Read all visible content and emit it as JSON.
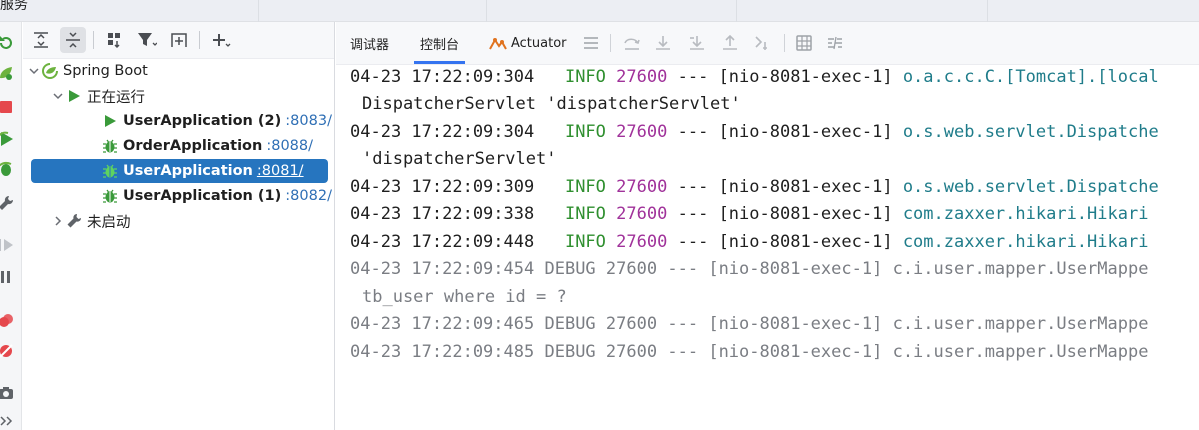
{
  "window": {
    "title": "服务"
  },
  "tree": {
    "root": {
      "label": "Spring Boot"
    },
    "running_group": {
      "label": "正在运行"
    },
    "apps": [
      {
        "name": "UserApplication (2)",
        "port": ":8083/"
      },
      {
        "name": "OrderApplication",
        "port": ":8088/"
      },
      {
        "name": "UserApplication",
        "port": ":8081/"
      },
      {
        "name": "UserApplication (1)",
        "port": ":8082/"
      }
    ],
    "stopped_group": {
      "label": "未启动"
    }
  },
  "console": {
    "tabs": [
      {
        "label": "调试器"
      },
      {
        "label": "控制台"
      },
      {
        "label": "Actuator"
      }
    ],
    "active_tab": "控制台",
    "lines": [
      {
        "time": "04-23 17:22:09:304",
        "level": " INFO",
        "pid": "27600",
        "sep": "---",
        "thread": "[nio-8081-exec-1]",
        "logger": "o.a.c.c.C.[Tomcat].[local"
      },
      {
        "cont": "DispatcherServlet 'dispatcherServlet'"
      },
      {
        "time": "04-23 17:22:09:304",
        "level": " INFO",
        "pid": "27600",
        "sep": "---",
        "thread": "[nio-8081-exec-1]",
        "logger": "o.s.web.servlet.Dispatche"
      },
      {
        "cont": "'dispatcherServlet'"
      },
      {
        "time": "04-23 17:22:09:309",
        "level": " INFO",
        "pid": "27600",
        "sep": "---",
        "thread": "[nio-8081-exec-1]",
        "logger": "o.s.web.servlet.Dispatche"
      },
      {
        "time": "04-23 17:22:09:338",
        "level": " INFO",
        "pid": "27600",
        "sep": "---",
        "thread": "[nio-8081-exec-1]",
        "logger": "com.zaxxer.hikari.Hikari"
      },
      {
        "time": "04-23 17:22:09:448",
        "level": " INFO",
        "pid": "27600",
        "sep": "---",
        "thread": "[nio-8081-exec-1]",
        "logger": "com.zaxxer.hikari.Hikari"
      },
      {
        "time": "04-23 17:22:09:454",
        "level": "DEBUG",
        "pid": "27600",
        "sep": "---",
        "thread": "[nio-8081-exec-1]",
        "logger": "c.i.user.mapper.UserMappe"
      },
      {
        "cont": "tb_user where id = ?"
      },
      {
        "time": "04-23 17:22:09:465",
        "level": "DEBUG",
        "pid": "27600",
        "sep": "---",
        "thread": "[nio-8081-exec-1]",
        "logger": "c.i.user.mapper.UserMappe"
      },
      {
        "time": "04-23 17:22:09:485",
        "level": "DEBUG",
        "pid": "27600",
        "sep": "---",
        "thread": "[nio-8081-exec-1]",
        "logger": "c.i.user.mapper.UserMappe"
      }
    ]
  },
  "colors": {
    "selection": "#2675bf",
    "info": "#2f8f2f",
    "debug": "#7a7d83",
    "pid": "#a0329a",
    "logger": "#1f7c8a",
    "port": "#2f6fb5",
    "active_tab_underline": "#3574f0"
  },
  "icons": {
    "left_strip": [
      "rerun-icon",
      "spring-run-icon",
      "stop-icon",
      "run-icon",
      "debug-icon",
      "wrench-icon",
      "resume-icon",
      "pause-icon",
      "breakpoints-icon",
      "mute-breakpoints-icon",
      "camera-icon",
      "more-icon"
    ],
    "tree_toolbar": [
      "expand-all-icon",
      "collapse-all-icon",
      "group-icon",
      "filter-icon",
      "new-service-icon",
      "add-icon"
    ],
    "console_toolbar": [
      "menu-icon",
      "step-over-icon",
      "step-into-icon",
      "force-step-into-icon",
      "step-out-icon",
      "run-to-cursor-icon",
      "evaluate-icon",
      "trace-icon"
    ]
  }
}
